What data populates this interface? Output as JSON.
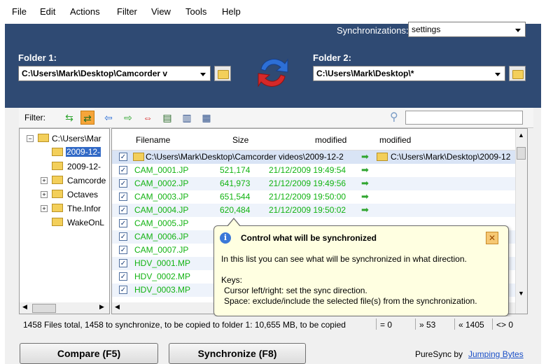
{
  "menu": [
    "File",
    "Edit",
    "Actions",
    "Filter",
    "View",
    "Tools",
    "Help"
  ],
  "sync": {
    "label": "Synchronizations:",
    "value": "settings"
  },
  "folder1": {
    "label": "Folder 1:",
    "value": "C:\\Users\\Mark\\Desktop\\Camcorder v"
  },
  "folder2": {
    "label": "Folder 2:",
    "value": "C:\\Users\\Mark\\Desktop\\*"
  },
  "filter": {
    "label": "Filter:",
    "search_value": ""
  },
  "tree": {
    "items": [
      {
        "label": "C:\\Users\\Mar"
      },
      {
        "label": "2009-12-"
      },
      {
        "label": "2009-12-"
      },
      {
        "label": "Camcorde"
      },
      {
        "label": "Octaves"
      },
      {
        "label": "The.Infor"
      },
      {
        "label": "WakeOnL"
      }
    ]
  },
  "list": {
    "headers": {
      "filename": "Filename",
      "size": "Size",
      "modified1": "modified",
      "modified2": "modified"
    },
    "folder_row": {
      "left": "C:\\Users\\Mark\\Desktop\\Camcorder videos\\2009-12-2",
      "right": "C:\\Users\\Mark\\Desktop\\2009-12"
    },
    "rows": [
      {
        "name": "CAM_0001.JP",
        "size": "521,174",
        "modified": "21/12/2009 19:49:54"
      },
      {
        "name": "CAM_0002.JP",
        "size": "641,973",
        "modified": "21/12/2009 19:49:56"
      },
      {
        "name": "CAM_0003.JP",
        "size": "651,544",
        "modified": "21/12/2009 19:50:00"
      },
      {
        "name": "CAM_0004.JP",
        "size": "620,484",
        "modified": "21/12/2009 19:50:02"
      },
      {
        "name": "CAM_0005.JP",
        "size": "",
        "modified": ""
      },
      {
        "name": "CAM_0006.JP",
        "size": "",
        "modified": ""
      },
      {
        "name": "CAM_0007.JP",
        "size": "",
        "modified": ""
      },
      {
        "name": "HDV_0001.MP",
        "size": "",
        "modified": ""
      },
      {
        "name": "HDV_0002.MP",
        "size": "",
        "modified": ""
      },
      {
        "name": "HDV_0003.MP",
        "size": "",
        "modified": ""
      }
    ]
  },
  "tooltip": {
    "title": "Control what will be synchronized",
    "line1": "In this list you can see what will be synchronized in what direction.",
    "keys": "Keys:",
    "key1": "Cursor left/right:  set the sync direction.",
    "key2": "Space:  exclude/include the selected file(s) from the synchronization."
  },
  "status": {
    "summary": "1458 Files total,  1458 to synchronize,  to be copied to folder 1: 10,655 MB,  to be copied",
    "c1": "= 0",
    "c2": "» 53",
    "c3": "« 1405",
    "c4": "<> 0"
  },
  "buttons": {
    "compare": "Compare (F5)",
    "synchronize": "Synchronize (F8)"
  },
  "footer": {
    "brand": "PureSync by",
    "link": "Jumping Bytes"
  },
  "colors": {
    "topbar": "#2f4a73",
    "green_text": "#12b312",
    "tooltip_bg": "#ffffe1"
  }
}
